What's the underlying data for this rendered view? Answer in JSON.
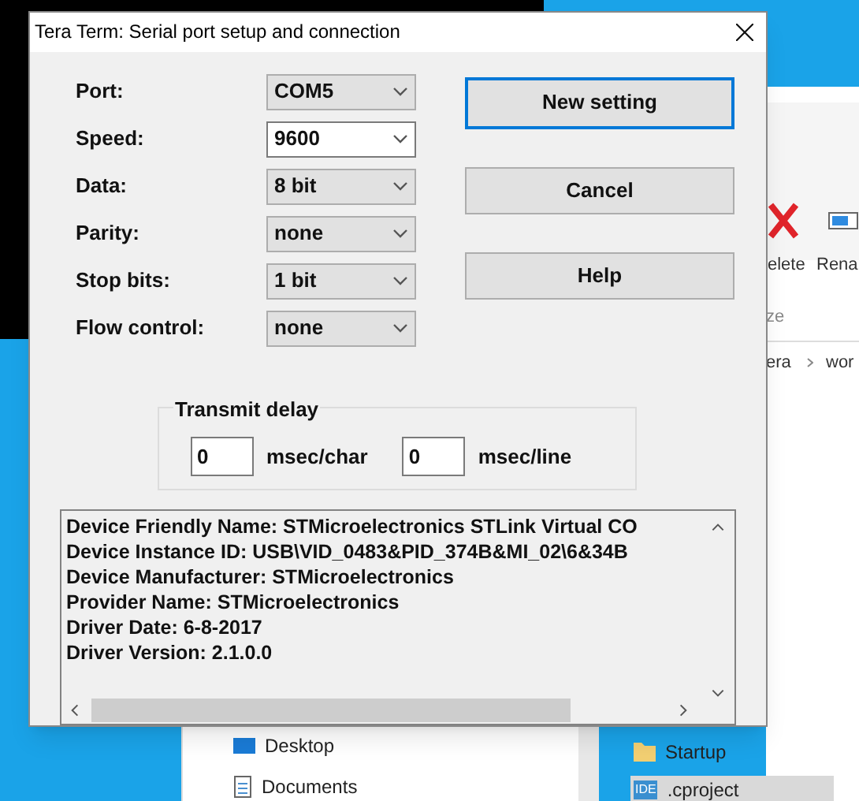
{
  "window": {
    "title": "Tera Term: Serial port setup and connection"
  },
  "fields": [
    {
      "label": "Port:",
      "value": "COM5",
      "focused": false
    },
    {
      "label": "Speed:",
      "value": "9600",
      "focused": true
    },
    {
      "label": "Data:",
      "value": "8 bit",
      "focused": false
    },
    {
      "label": "Parity:",
      "value": "none",
      "focused": false
    },
    {
      "label": "Stop bits:",
      "value": "1 bit",
      "focused": false
    },
    {
      "label": "Flow control:",
      "value": "none",
      "focused": false
    }
  ],
  "buttons": [
    {
      "label": "New setting",
      "default": true
    },
    {
      "label": "Cancel",
      "default": false
    },
    {
      "label": "Help",
      "default": false
    }
  ],
  "transmit_delay": {
    "title": "Transmit delay",
    "inputs": [
      {
        "value": "0",
        "unit": "msec/char"
      },
      {
        "value": "0",
        "unit": "msec/line"
      }
    ]
  },
  "device_info": [
    "Device Friendly Name: STMicroelectronics STLink Virtual CO",
    "Device Instance ID: USB\\VID_0483&PID_374B&MI_02\\6&34B",
    "Device Manufacturer: STMicroelectronics",
    "Provider Name: STMicroelectronics",
    "Driver Date: 6-8-2017",
    "Driver Version: 2.1.0.0"
  ],
  "background": {
    "ribbon": [
      "elete",
      "Rena"
    ],
    "group_label": "ze",
    "breadcrumb": [
      "era",
      "wor"
    ],
    "nav_items": [
      "Desktop",
      "Documents"
    ],
    "files": [
      {
        "name": "Startup",
        "kind": "folder"
      },
      {
        "name": ".cproject",
        "kind": "ide"
      }
    ],
    "ide_badge": "IDE"
  }
}
